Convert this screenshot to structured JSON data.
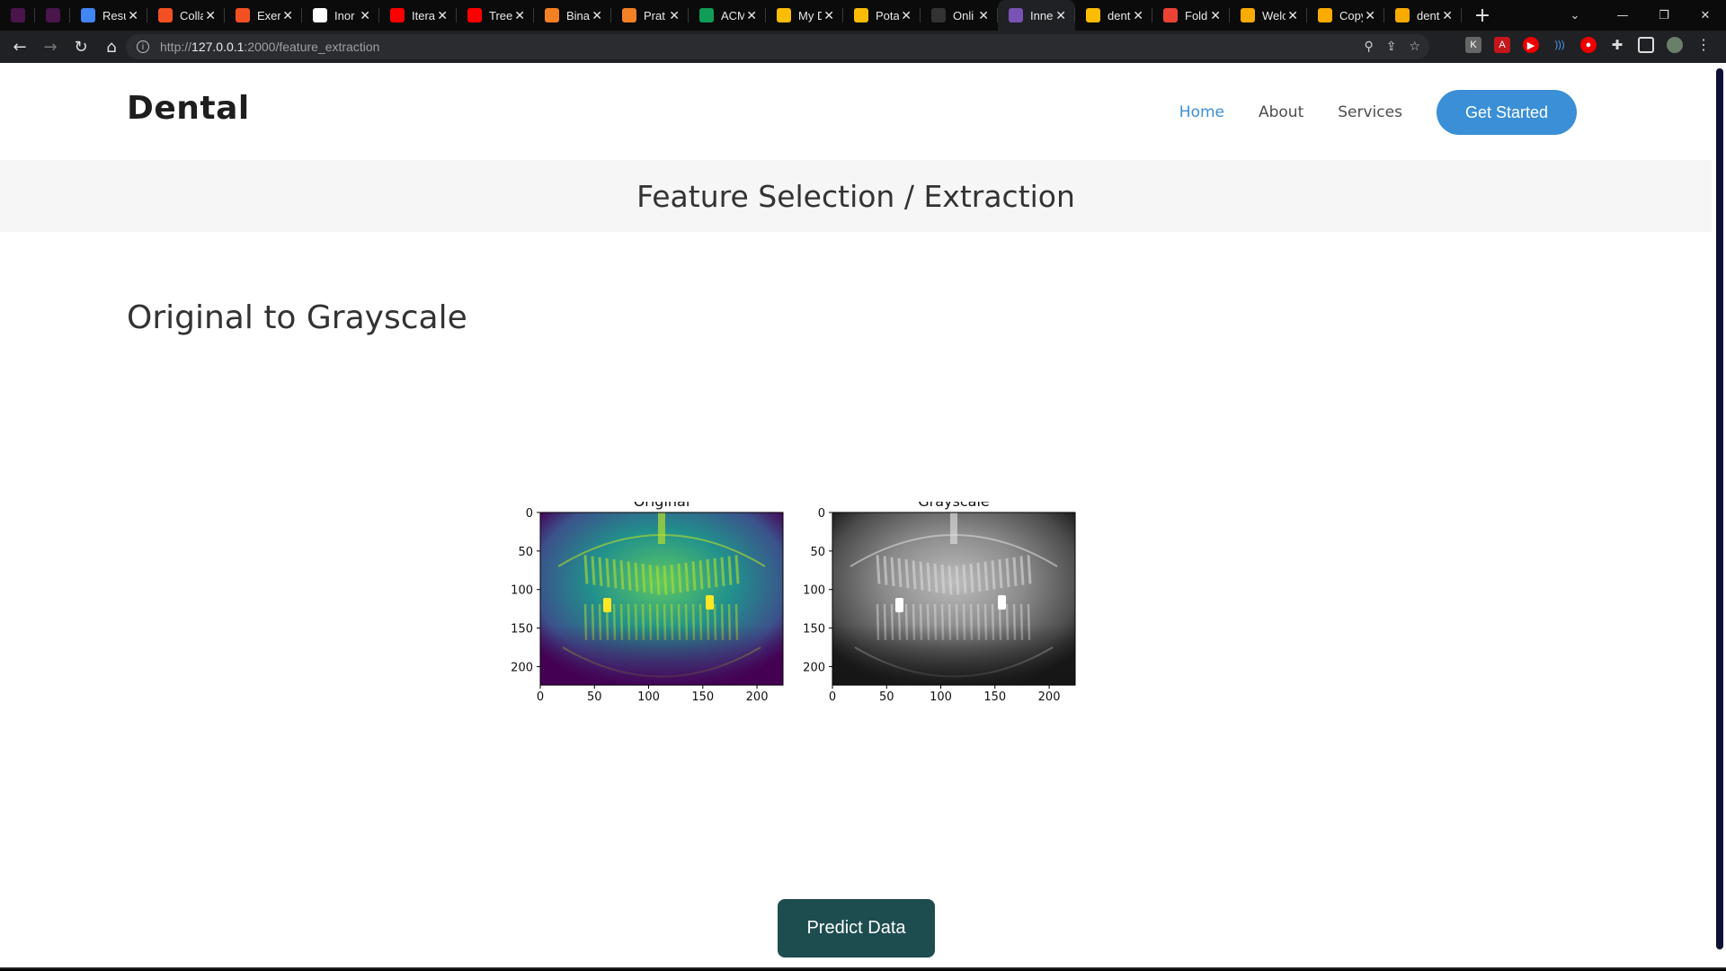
{
  "browser": {
    "tabs": [
      {
        "label": "",
        "favicon": "slack-icon",
        "color": "#4a154b",
        "pinned": true
      },
      {
        "label": "",
        "favicon": "slack-icon",
        "color": "#4a154b",
        "pinned": true
      },
      {
        "label": "Resu",
        "favicon": "docs-icon",
        "color": "#4285f4"
      },
      {
        "label": "Colla",
        "favicon": "microsoft-icon",
        "color": "#f25022"
      },
      {
        "label": "Exer",
        "favicon": "microsoft-icon",
        "color": "#f25022"
      },
      {
        "label": "Inor",
        "favicon": "google-icon",
        "color": "#ffffff"
      },
      {
        "label": "Itera",
        "favicon": "youtube-icon",
        "color": "#ff0000"
      },
      {
        "label": "Tree",
        "favicon": "youtube-icon",
        "color": "#ff0000"
      },
      {
        "label": "Bina",
        "favicon": "stackoverflow-icon",
        "color": "#f48024"
      },
      {
        "label": "Prat",
        "favicon": "stackoverflow-icon",
        "color": "#f48024"
      },
      {
        "label": "ACM",
        "favicon": "sheets-icon",
        "color": "#0f9d58"
      },
      {
        "label": "My D",
        "favicon": "drive-icon",
        "color": "#fbbc04"
      },
      {
        "label": "Pota",
        "favicon": "drive-icon",
        "color": "#fbbc04"
      },
      {
        "label": "Onli",
        "favicon": "d-icon",
        "color": "#333333"
      },
      {
        "label": "Inne",
        "favicon": "bootstrap-icon",
        "color": "#7952b3",
        "active": true
      },
      {
        "label": "dent",
        "favicon": "drive-icon",
        "color": "#fbbc04"
      },
      {
        "label": "Fold",
        "favicon": "gmail-icon",
        "color": "#ea4335"
      },
      {
        "label": "Welc",
        "favicon": "colab-icon",
        "color": "#f9ab00"
      },
      {
        "label": "Copy",
        "favicon": "colab-icon",
        "color": "#f9ab00"
      },
      {
        "label": "dent",
        "favicon": "colab-icon",
        "color": "#f9ab00"
      }
    ],
    "url_scheme": "http://",
    "url_host": "127.0.0.1",
    "url_rest": ":2000/feature_extraction"
  },
  "site": {
    "logo": "Dental",
    "nav": [
      {
        "label": "Home",
        "active": true
      },
      {
        "label": "About"
      },
      {
        "label": "Services"
      }
    ],
    "cta": "Get Started"
  },
  "banner_title": "Feature Selection / Extraction",
  "section_title": "Original to Grayscale",
  "figure": {
    "panels": [
      {
        "title": "Original",
        "colormap": "viridis"
      },
      {
        "title": "Grayscale",
        "colormap": "gray"
      }
    ],
    "x_ticks": [
      "0",
      "50",
      "100",
      "150",
      "200"
    ],
    "y_ticks": [
      "0",
      "50",
      "100",
      "150",
      "200"
    ],
    "xlim": [
      0,
      224
    ],
    "ylim": [
      224,
      0
    ]
  },
  "predict_button": "Predict Data"
}
